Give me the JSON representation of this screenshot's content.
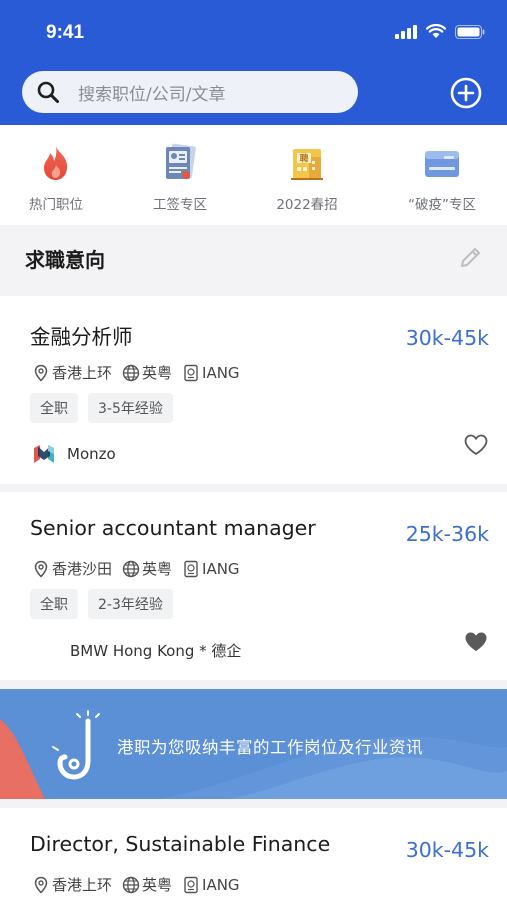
{
  "status_bar": {
    "time": "9:41"
  },
  "search": {
    "placeholder": "搜索职位/公司/文章"
  },
  "quick_nav": [
    {
      "label": "热门职位",
      "icon": "flame-icon"
    },
    {
      "label": "工签专区",
      "icon": "visa-document-icon"
    },
    {
      "label": "2022春招",
      "icon": "recruitment-building-icon"
    },
    {
      "label": "“破疫”专区",
      "icon": "card-icon"
    }
  ],
  "intent_section": {
    "title": "求職意向"
  },
  "jobs": [
    {
      "title": "金融分析师",
      "salary": "30k-45k",
      "location": "香港上环",
      "language": "英粤",
      "visa": "IANG",
      "tags": [
        "全职",
        "3-5年经验"
      ],
      "company": "Monzo",
      "favorited": false
    },
    {
      "title": "Senior accountant manager",
      "salary": "25k-36k",
      "location": "香港沙田",
      "language": "英粤",
      "visa": "IANG",
      "tags": [
        "全职",
        "2-3年经验"
      ],
      "company": "BMW Hong Kong * 德企",
      "favorited": true
    },
    {
      "title": "Director, Sustainable Finance",
      "salary": "30k-45k",
      "location": "香港上环",
      "language": "英粤",
      "visa": "IANG"
    }
  ],
  "banner": {
    "text": "港职为您吸纳丰富的工作岗位及行业资讯"
  },
  "colors": {
    "header": "#2a5bd7",
    "salary": "#3b6fd0",
    "banner": "#5b8fd6"
  }
}
